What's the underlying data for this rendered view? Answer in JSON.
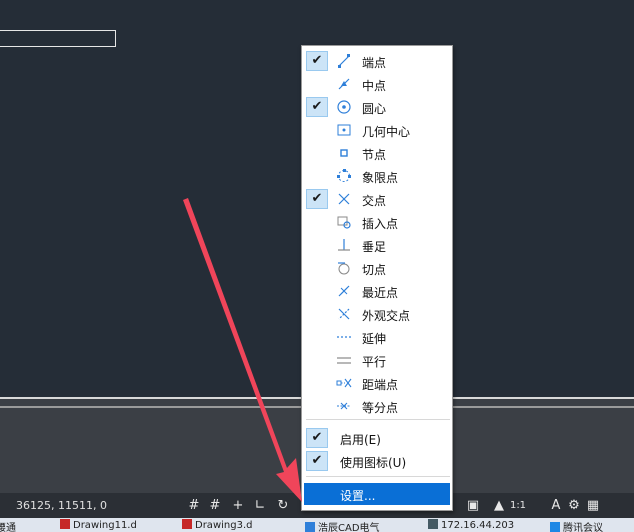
{
  "status": {
    "coords": "36125, 11511, 0",
    "scale": "1:1"
  },
  "snap_menu": {
    "items": [
      {
        "label": "端点",
        "checked": true,
        "icon": "endpoint-icon"
      },
      {
        "label": "中点",
        "checked": false,
        "icon": "midpoint-icon"
      },
      {
        "label": "圆心",
        "checked": true,
        "icon": "center-icon"
      },
      {
        "label": "几何中心",
        "checked": false,
        "icon": "geometric-center-icon"
      },
      {
        "label": "节点",
        "checked": false,
        "icon": "node-icon"
      },
      {
        "label": "象限点",
        "checked": false,
        "icon": "quadrant-icon"
      },
      {
        "label": "交点",
        "checked": true,
        "icon": "intersection-icon"
      },
      {
        "label": "插入点",
        "checked": false,
        "icon": "insertion-icon"
      },
      {
        "label": "垂足",
        "checked": false,
        "icon": "perpendicular-icon"
      },
      {
        "label": "切点",
        "checked": false,
        "icon": "tangent-icon"
      },
      {
        "label": "最近点",
        "checked": false,
        "icon": "nearest-icon"
      },
      {
        "label": "外观交点",
        "checked": false,
        "icon": "apparent-intersection-icon"
      },
      {
        "label": "延伸",
        "checked": false,
        "icon": "extension-icon"
      },
      {
        "label": "平行",
        "checked": false,
        "icon": "parallel-icon"
      },
      {
        "label": "距端点",
        "checked": false,
        "icon": "from-endpoint-icon"
      },
      {
        "label": "等分点",
        "checked": false,
        "icon": "divide-icon"
      }
    ],
    "enable_label": "启用(E)",
    "use_icons_label": "使用图标(U)",
    "settings_label": "设置..."
  },
  "taskbar": [
    {
      "label": "腰通"
    },
    {
      "label": "Drawing11.d"
    },
    {
      "label": "Drawing3.d"
    },
    {
      "label": "浩辰CAD电气"
    },
    {
      "label": "172.16.44.203"
    },
    {
      "label": "腾讯会议"
    }
  ],
  "colors": {
    "accent": "#0a6fd6",
    "arrow": "#f0455a",
    "check_bg": "#cce4f7",
    "icon_blue": "#2e7fd9"
  }
}
